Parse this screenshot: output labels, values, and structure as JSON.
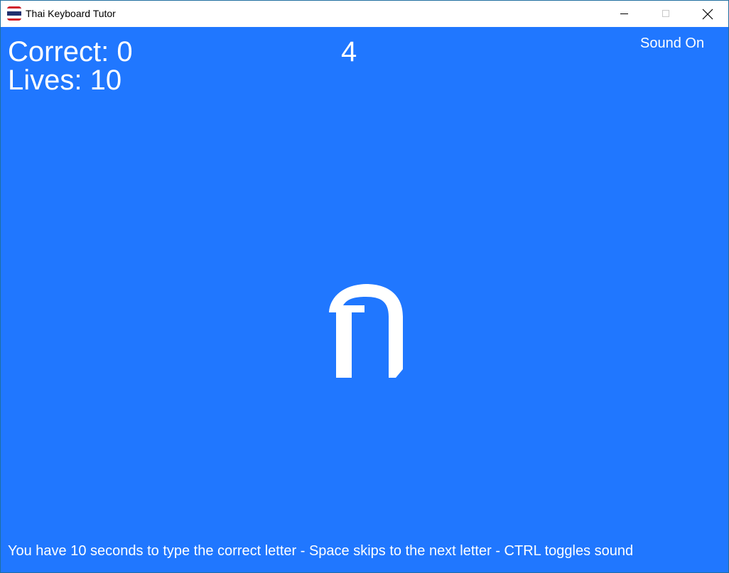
{
  "window": {
    "title": "Thai Keyboard Tutor",
    "icon": "thai-flag-icon"
  },
  "game": {
    "background_color": "#2077ff",
    "text_color": "#ffffff",
    "correct_label": "Correct: 0",
    "lives_label": "Lives: 10",
    "timer": "4",
    "sound_label": "Sound On",
    "current_letter": "ฦ",
    "instructions": "You have 10 seconds to type the correct letter - Space skips to the next letter - CTRL toggles sound"
  }
}
